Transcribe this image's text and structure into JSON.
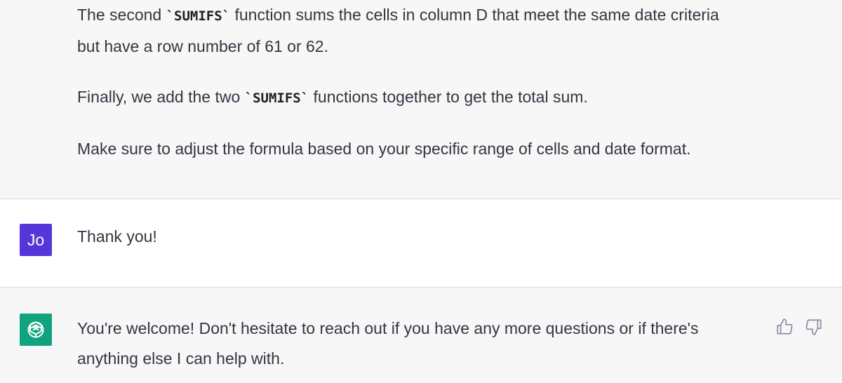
{
  "previous_assistant": {
    "p1_before": "The second ",
    "p1_code": "`SUMIFS`",
    "p1_after": " function sums the cells in column D that meet the same date criteria",
    "p1_line2": "but have a row number of 61 or 62.",
    "p2_before": "Finally, we add the two ",
    "p2_code": "`SUMIFS`",
    "p2_after": " functions together to get the total sum.",
    "p3": "Make sure to adjust the formula based on your specific range of cells and date format."
  },
  "user_message": {
    "avatar_initials": "Jo",
    "text": "Thank you!"
  },
  "assistant_reply": {
    "avatar_icon": "openai-logo-icon",
    "line1": "You're welcome! Don't hesitate to reach out if you have any more questions or if there's",
    "line2": "anything else I can help with.",
    "thumbs_up_icon": "thumbs-up-icon",
    "thumbs_down_icon": "thumbs-down-icon"
  },
  "colors": {
    "assistant_bg": "#f7f7f8",
    "user_bg": "#ffffff",
    "user_avatar": "#5436da",
    "bot_avatar": "#10a37f",
    "text": "#343541",
    "divider": "#d9d9e3"
  }
}
